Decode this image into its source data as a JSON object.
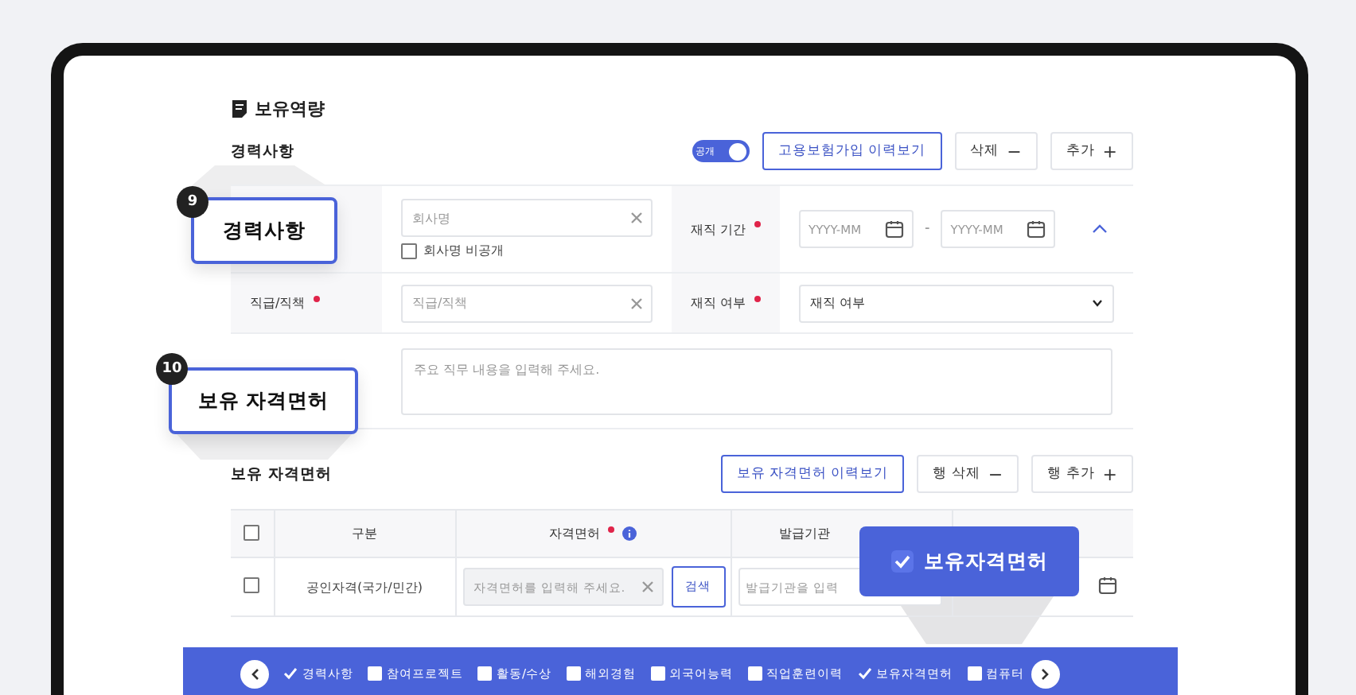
{
  "section_title": "보유역량",
  "career": {
    "title": "경력사항",
    "public_toggle": {
      "label": "공개",
      "on": true
    },
    "buttons": [
      {
        "label": "고용보험가입 이력보기",
        "kind": "outline"
      },
      {
        "label": "삭제",
        "icon": "−",
        "kind": "plain"
      },
      {
        "label": "추가",
        "icon": "+",
        "kind": "plain"
      }
    ],
    "expanded": true,
    "company": {
      "placeholder": "회사명"
    },
    "hide_company": {
      "label": "회사명 비공개",
      "checked": false
    },
    "period": {
      "label": "재직 기간",
      "required": true,
      "start_placeholder": "YYYY-MM",
      "separator": "-",
      "end_placeholder": "YYYY-MM"
    },
    "position": {
      "label": "직급/직책",
      "required": true,
      "placeholder": "직급/직책"
    },
    "status": {
      "label": "재직 여부",
      "required": true,
      "value": "재직 여부"
    },
    "duties": {
      "placeholder": "주요 직무 내용을 입력해 주세요."
    }
  },
  "licenses": {
    "title": "보유 자격면허",
    "buttons": [
      {
        "label": "보유 자격면허 이력보기",
        "kind": "outline"
      },
      {
        "label": "행 삭제",
        "icon": "−",
        "kind": "plain"
      },
      {
        "label": "행 추가",
        "icon": "+",
        "kind": "plain"
      }
    ],
    "table": {
      "all_checked": false,
      "columns": [
        {
          "label": "구분"
        },
        {
          "label": "자격면허",
          "required": true,
          "info": true
        },
        {
          "label": "발급기관"
        }
      ],
      "rows": [
        {
          "checked": false,
          "type": "공인자격(국가/민간)",
          "license_placeholder": "자격면허를 입력해 주세요.",
          "search_label": "검색",
          "issuer_placeholder": "발급기관을 입력"
        }
      ]
    }
  },
  "callouts": [
    {
      "number": "9",
      "label": "경력사항"
    },
    {
      "number": "10",
      "label": "보유 자격면허"
    }
  ],
  "tooltip": {
    "label": "보유자격면허",
    "checked": true
  },
  "nav": {
    "items": [
      {
        "label": "경력사항",
        "checked": true
      },
      {
        "label": "참여프로젝트",
        "checked": false
      },
      {
        "label": "활동/수상",
        "checked": false
      },
      {
        "label": "해외경험",
        "checked": false
      },
      {
        "label": "외국어능력",
        "checked": false
      },
      {
        "label": "직업훈련이력",
        "checked": false
      },
      {
        "label": "보유자격면허",
        "checked": true
      },
      {
        "label": "컴퓨터",
        "checked": false
      }
    ]
  }
}
